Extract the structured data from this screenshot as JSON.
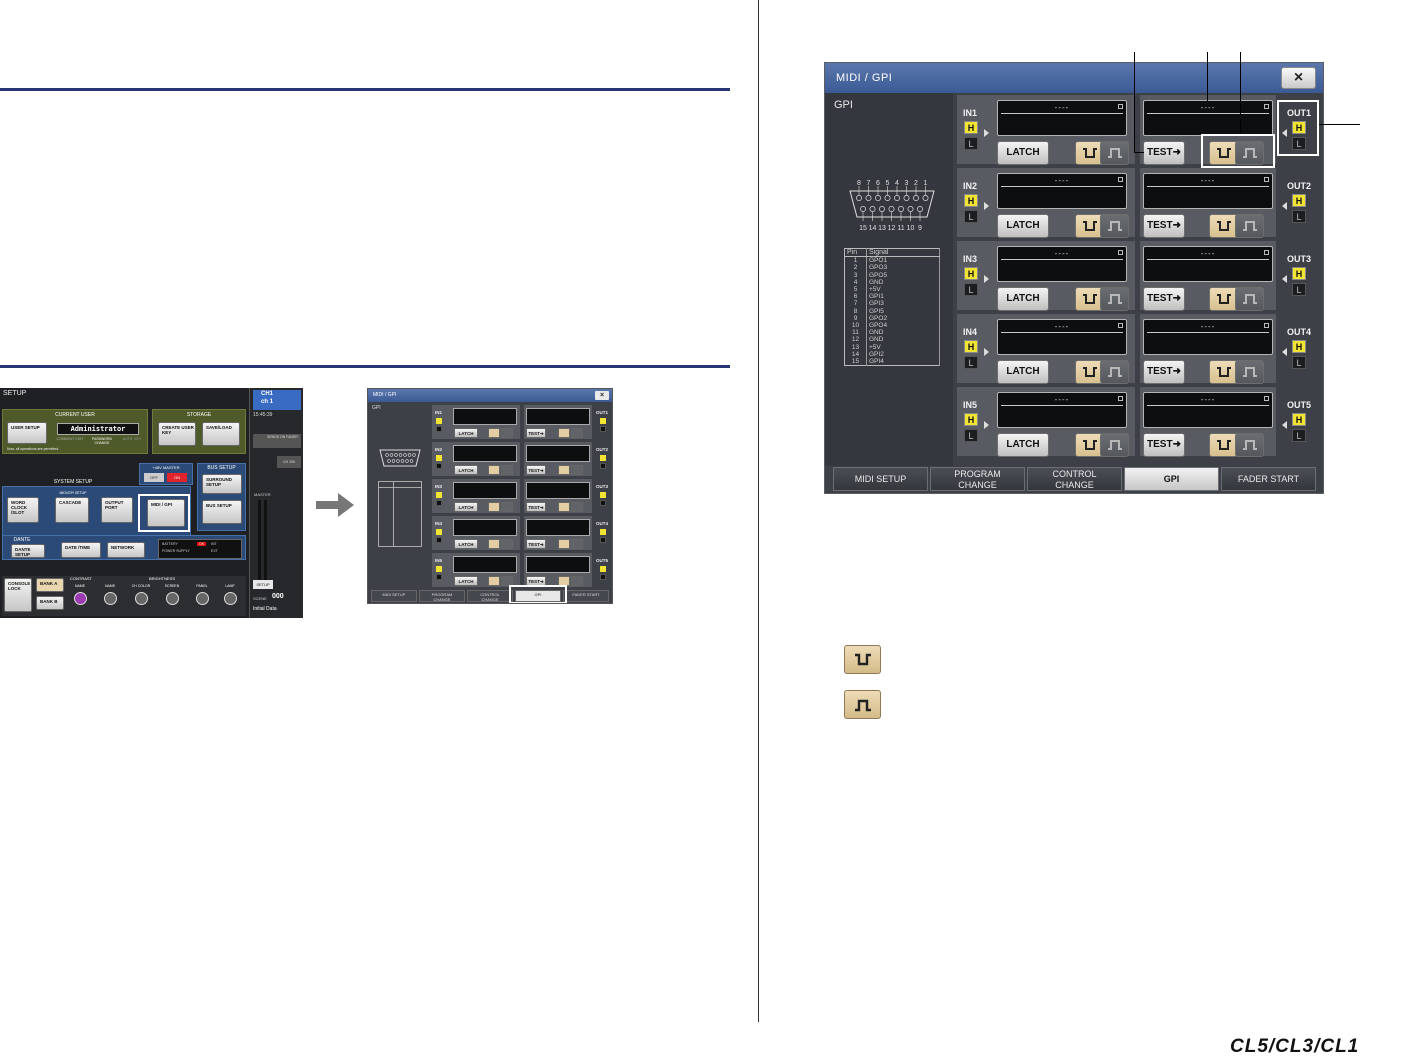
{
  "window": {
    "title": "MIDI / GPI",
    "close_symbol": "×",
    "section_label": "GPI",
    "connector_pins_top": [
      "8",
      "7",
      "6",
      "5",
      "4",
      "3",
      "2",
      "1"
    ],
    "connector_pins_bottom": [
      "15",
      "14",
      "13",
      "12",
      "11",
      "10",
      "9"
    ],
    "pin_table": {
      "headers": [
        "Pin",
        "Signal"
      ],
      "rows": [
        [
          "1",
          "GPO1"
        ],
        [
          "2",
          "GPO3"
        ],
        [
          "3",
          "GPO5"
        ],
        [
          "4",
          "GND"
        ],
        [
          "5",
          "+5V"
        ],
        [
          "6",
          "GPI1"
        ],
        [
          "7",
          "GPI3"
        ],
        [
          "8",
          "GPI5"
        ],
        [
          "9",
          "GPO2"
        ],
        [
          "10",
          "GPO4"
        ],
        [
          "11",
          "GND"
        ],
        [
          "12",
          "GND"
        ],
        [
          "13",
          "+5V"
        ],
        [
          "14",
          "GPI2"
        ],
        [
          "15",
          "GPI4"
        ]
      ]
    },
    "rows": [
      {
        "in_label": "IN1",
        "out_label": "OUT1"
      },
      {
        "in_label": "IN2",
        "out_label": "OUT2"
      },
      {
        "in_label": "IN3",
        "out_label": "OUT3"
      },
      {
        "in_label": "IN4",
        "out_label": "OUT4"
      },
      {
        "in_label": "IN5",
        "out_label": "OUT5"
      }
    ],
    "h_label": "H",
    "l_label": "L",
    "name_placeholder": "----",
    "latch_label": "LATCH",
    "test_label": "TEST➜",
    "tabs": [
      {
        "line1": "MIDI SETUP",
        "line2": ""
      },
      {
        "line1": "PROGRAM",
        "line2": "CHANGE"
      },
      {
        "line1": "CONTROL",
        "line2": "CHANGE"
      },
      {
        "line1": "GPI",
        "line2": ""
      },
      {
        "line1": "FADER START",
        "line2": ""
      }
    ]
  },
  "setup_screen": {
    "title": "SETUP",
    "current_user_label": "CURRENT USER",
    "storage_label": "STORAGE",
    "user_setup": "USER SETUP",
    "user_name": "Administrator",
    "comment_edit": "COMMENT EDIT",
    "password_change": "PASSWORD CHANGE",
    "auth_key": "AUTH. KEY",
    "permission_text": "Now, all operations are permitted.",
    "create_user_key": "CREATE USER KEY",
    "save_load": "SAVE/LOAD",
    "system_setup_label": "SYSTEM SETUP",
    "master_48v_label": "+48V MASTER",
    "off": "OFF",
    "on": "ON",
    "bus_setup_label": "BUS SETUP",
    "midi_gpi_setup": "MIDI/GPI SETUP",
    "word_clock": "WORD CLOCK /SLOT",
    "cascade": "CASCADE",
    "output_port": "OUTPUT PORT",
    "midi_gpi": "MIDI / GPI",
    "surround_setup": "SURROUND SETUP",
    "bus_setup": "BUS SETUP",
    "dante_label": "DANTE",
    "dante_setup": "DANTE SETUP",
    "date_time": "DATE /TIME",
    "network": "NETWORK",
    "battery": "BATTERY",
    "battery_state": "OK",
    "power_supply": "POWER SUPPLY",
    "int": "INT",
    "ext": "EXT",
    "console_lock": "CONSOLE LOCK",
    "bank_a": "BANK A",
    "bank_b": "BANK B",
    "contrast_label": "CONTRAST",
    "name": "NAME",
    "brightness_label": "BRIGHTNESS",
    "ch_color": "CH COLOR",
    "screen": "SCREEN",
    "panel": "PANEL",
    "lamp": "LAMP",
    "channel_line1": "CH1",
    "channel_line2": "ch 1",
    "time": "15:45:39",
    "sends_on_fader": "SENDS ON FADER",
    "ch_label": "CH 209",
    "master_label": "MASTER",
    "setup_btn": "SETUP",
    "scene_label": "SCENE",
    "scene_number": "000",
    "scene_name": "Initial Data"
  },
  "page_footer": {
    "logo": "CL5/CL3/CL1"
  }
}
